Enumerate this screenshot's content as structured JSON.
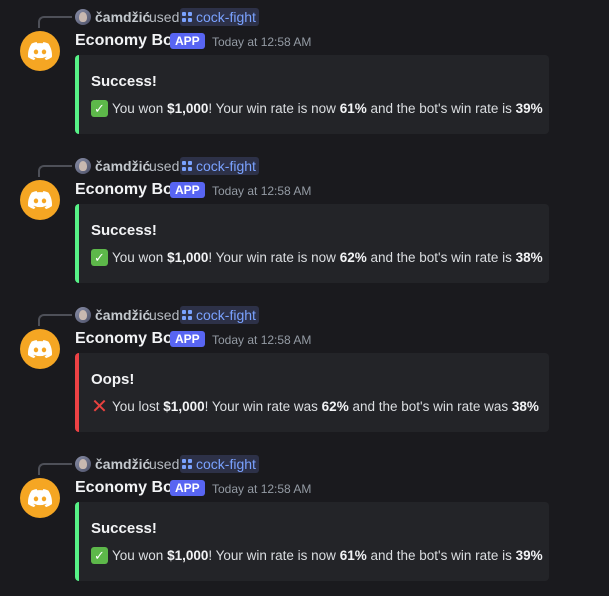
{
  "colors": {
    "success": "#57f287",
    "error": "#ed4245",
    "avatar_bg": "#f5a623",
    "app_badge": "#5865f2"
  },
  "messages": [
    {
      "reply": {
        "user": "čamdžić",
        "used": "used",
        "command": "cock-fight"
      },
      "bot": {
        "name": "Economy Bot",
        "badge": "APP",
        "time": "Today at 12:58 AM"
      },
      "embed": {
        "status": "success",
        "title": "Success!",
        "icon": "check-mark-icon",
        "t1": "You won ",
        "amount": "$1,000",
        "t2": "! Your win rate is now ",
        "user_rate": "61%",
        "t3": " and the bot's win rate is ",
        "bot_rate": "39%"
      }
    },
    {
      "reply": {
        "user": "čamdžić",
        "used": "used",
        "command": "cock-fight"
      },
      "bot": {
        "name": "Economy Bot",
        "badge": "APP",
        "time": "Today at 12:58 AM"
      },
      "embed": {
        "status": "success",
        "title": "Success!",
        "icon": "check-mark-icon",
        "t1": "You won ",
        "amount": "$1,000",
        "t2": "! Your win rate is now ",
        "user_rate": "62%",
        "t3": " and the bot's win rate is ",
        "bot_rate": "38%"
      }
    },
    {
      "reply": {
        "user": "čamdžić",
        "used": "used",
        "command": "cock-fight"
      },
      "bot": {
        "name": "Economy Bot",
        "badge": "APP",
        "time": "Today at 12:58 AM"
      },
      "embed": {
        "status": "error",
        "title": "Oops!",
        "icon": "cross-mark-icon",
        "t1": "You lost ",
        "amount": "$1,000",
        "t2": "! Your win rate was ",
        "user_rate": "62%",
        "t3": " and the bot's win rate was ",
        "bot_rate": "38%"
      }
    },
    {
      "reply": {
        "user": "čamdžić",
        "used": "used",
        "command": "cock-fight"
      },
      "bot": {
        "name": "Economy Bot",
        "badge": "APP",
        "time": "Today at 12:58 AM"
      },
      "embed": {
        "status": "success",
        "title": "Success!",
        "icon": "check-mark-icon",
        "t1": "You won ",
        "amount": "$1,000",
        "t2": "! Your win rate is now ",
        "user_rate": "61%",
        "t3": " and the bot's win rate is ",
        "bot_rate": "39%"
      }
    }
  ]
}
